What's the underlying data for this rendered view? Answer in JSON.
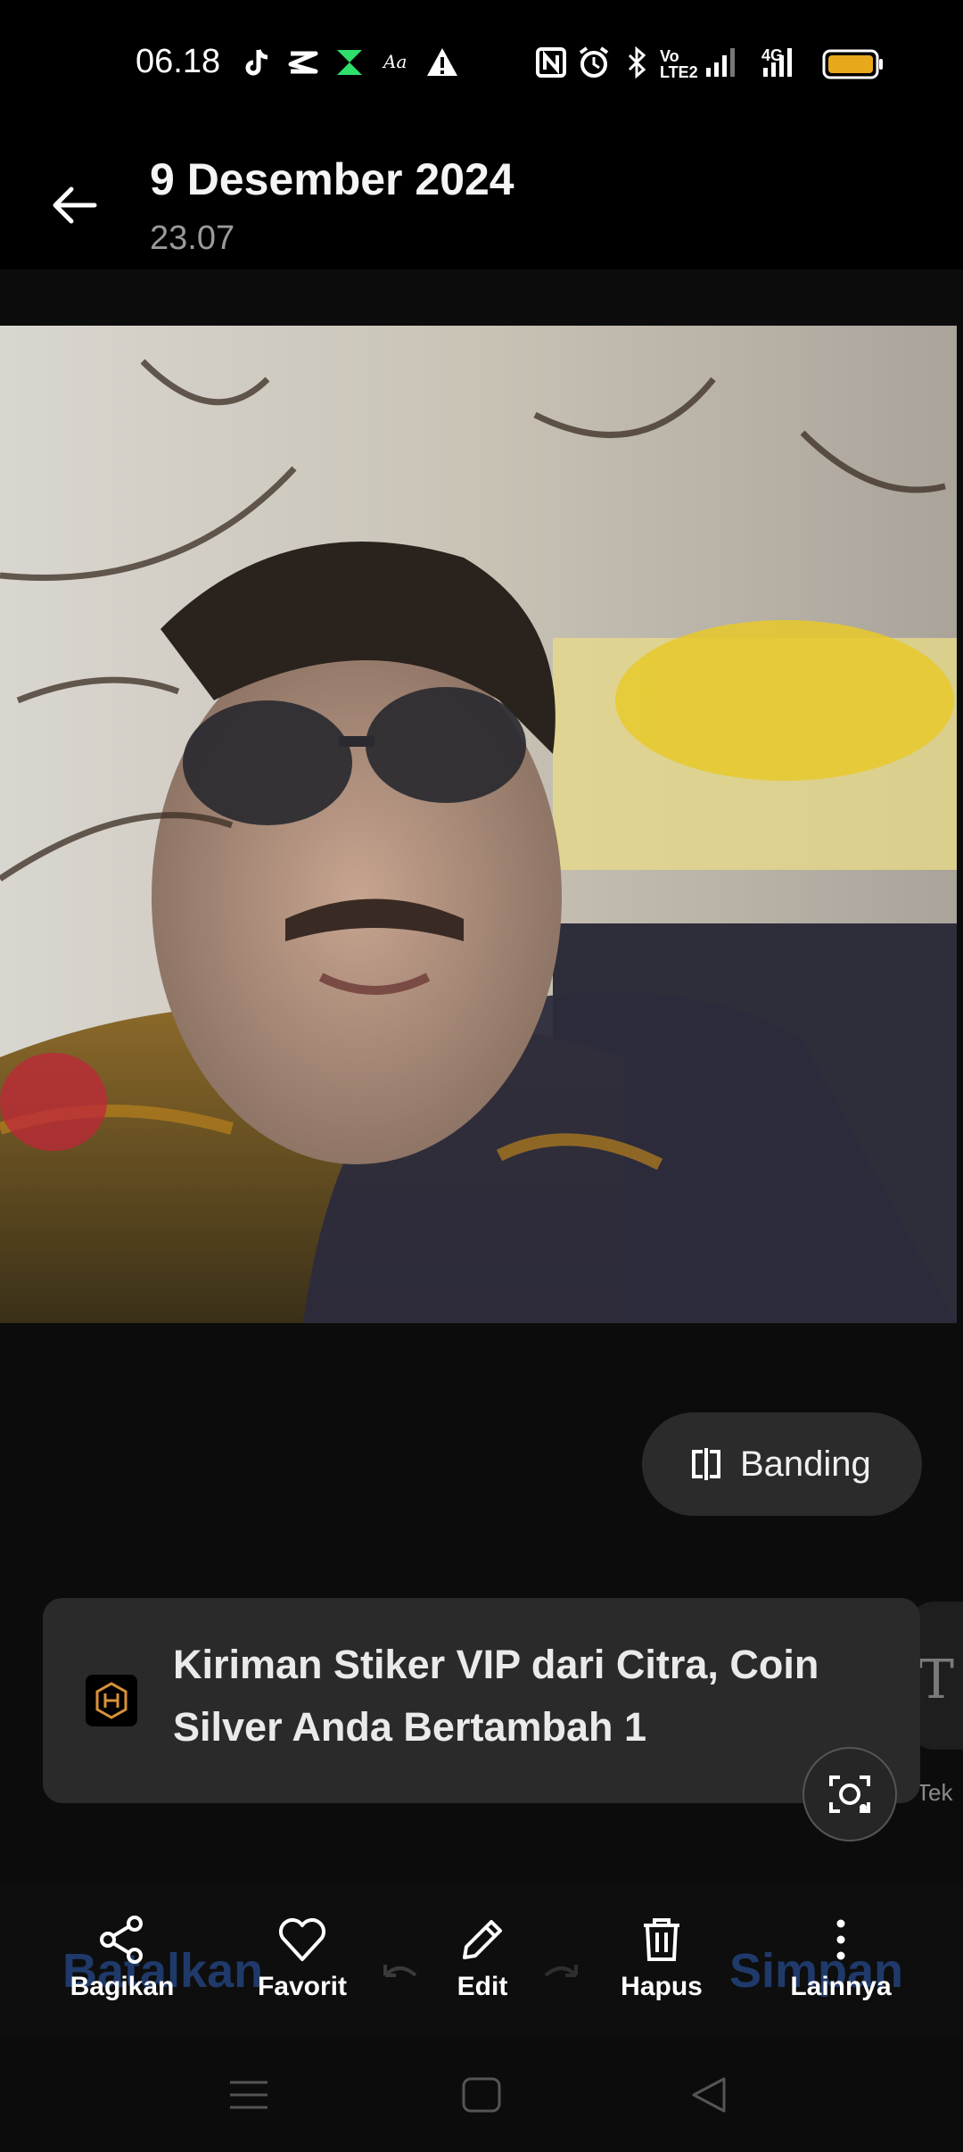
{
  "status_bar": {
    "time": "06.18",
    "icons": [
      "tiktok-icon",
      "capcut-icon",
      "xender-icon",
      "ai-icon",
      "warning-icon",
      "nfc-icon",
      "alarm-icon",
      "bluetooth-icon",
      "volte-icon",
      "signal-icon",
      "signal-4g-icon",
      "battery-icon"
    ],
    "volte_label": "Vo\nLTE2",
    "network_label": "4G"
  },
  "header": {
    "title": "9 Desember 2024",
    "subtitle": "23.07"
  },
  "compare": {
    "label": "Banding"
  },
  "toast": {
    "message": "Kiriman Stiker VIP dari Citra, Coin Silver Anda Bertambah 1"
  },
  "side_panel": {
    "letter": "T",
    "label": "Tek"
  },
  "toolbar": {
    "ghost_left": "Batalkan",
    "ghost_right": "Simpan",
    "items": [
      {
        "label": "Bagikan",
        "icon": "share-icon"
      },
      {
        "label": "Favorit",
        "icon": "heart-icon"
      },
      {
        "label": "Edit",
        "icon": "pencil-icon"
      },
      {
        "label": "Hapus",
        "icon": "trash-icon"
      },
      {
        "label": "Lainnya",
        "icon": "more-vertical-icon"
      }
    ]
  },
  "colors": {
    "background": "#0c0c0c",
    "chip": "#2b2b2b",
    "toast": "#2a2a2a",
    "accent_ghost": "#1f3a6a"
  }
}
